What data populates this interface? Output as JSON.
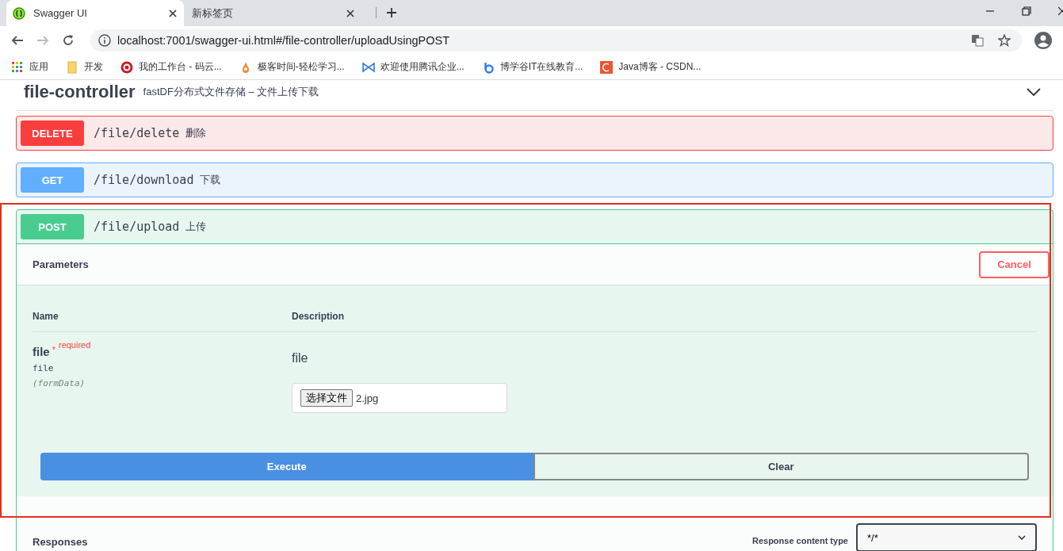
{
  "browser": {
    "tabs": [
      {
        "title": "Swagger UI",
        "selected": true
      },
      {
        "title": "新标签页",
        "selected": false
      }
    ],
    "address": "localhost:7001/swagger-ui.html#/file-controller/uploadUsingPOST",
    "bookmarks": [
      {
        "label": "应用",
        "kind": "apps"
      },
      {
        "label": "开发",
        "kind": "folder"
      },
      {
        "label": "我的工作台 - 码云...",
        "kind": "gitee"
      },
      {
        "label": "极客时间-轻松学习...",
        "kind": "geek"
      },
      {
        "label": "欢迎使用腾讯企业...",
        "kind": "tencent"
      },
      {
        "label": "博学谷IT在线教育...",
        "kind": "boxuegu"
      },
      {
        "label": "Java博客 - CSDN...",
        "kind": "csdn"
      }
    ]
  },
  "section": {
    "name": "file-controller",
    "description": "fastDF分布式文件存储 – 文件上传下载",
    "expanded": true
  },
  "operations": [
    {
      "method": "DELETE",
      "kind": "delete",
      "path": "/file/delete",
      "summary": "删除"
    },
    {
      "method": "GET",
      "kind": "get",
      "path": "/file/download",
      "summary": "下载"
    },
    {
      "method": "POST",
      "kind": "post",
      "path": "/file/upload",
      "summary": "上传",
      "try_it": {
        "title": "Parameters",
        "cancel": "Cancel",
        "columns": [
          "Name",
          "Description"
        ],
        "params": [
          {
            "name": "file",
            "required_mark": "*",
            "required": "required",
            "type": "file",
            "location": "(formData)",
            "description": "file",
            "file_button": "选择文件",
            "file_name": "2.jpg"
          }
        ],
        "execute": "Execute",
        "clear": "Clear"
      },
      "responses": {
        "title": "Responses",
        "content_type_label": "Response content type",
        "content_type_value": "*/*"
      }
    }
  ],
  "highlight": true
}
